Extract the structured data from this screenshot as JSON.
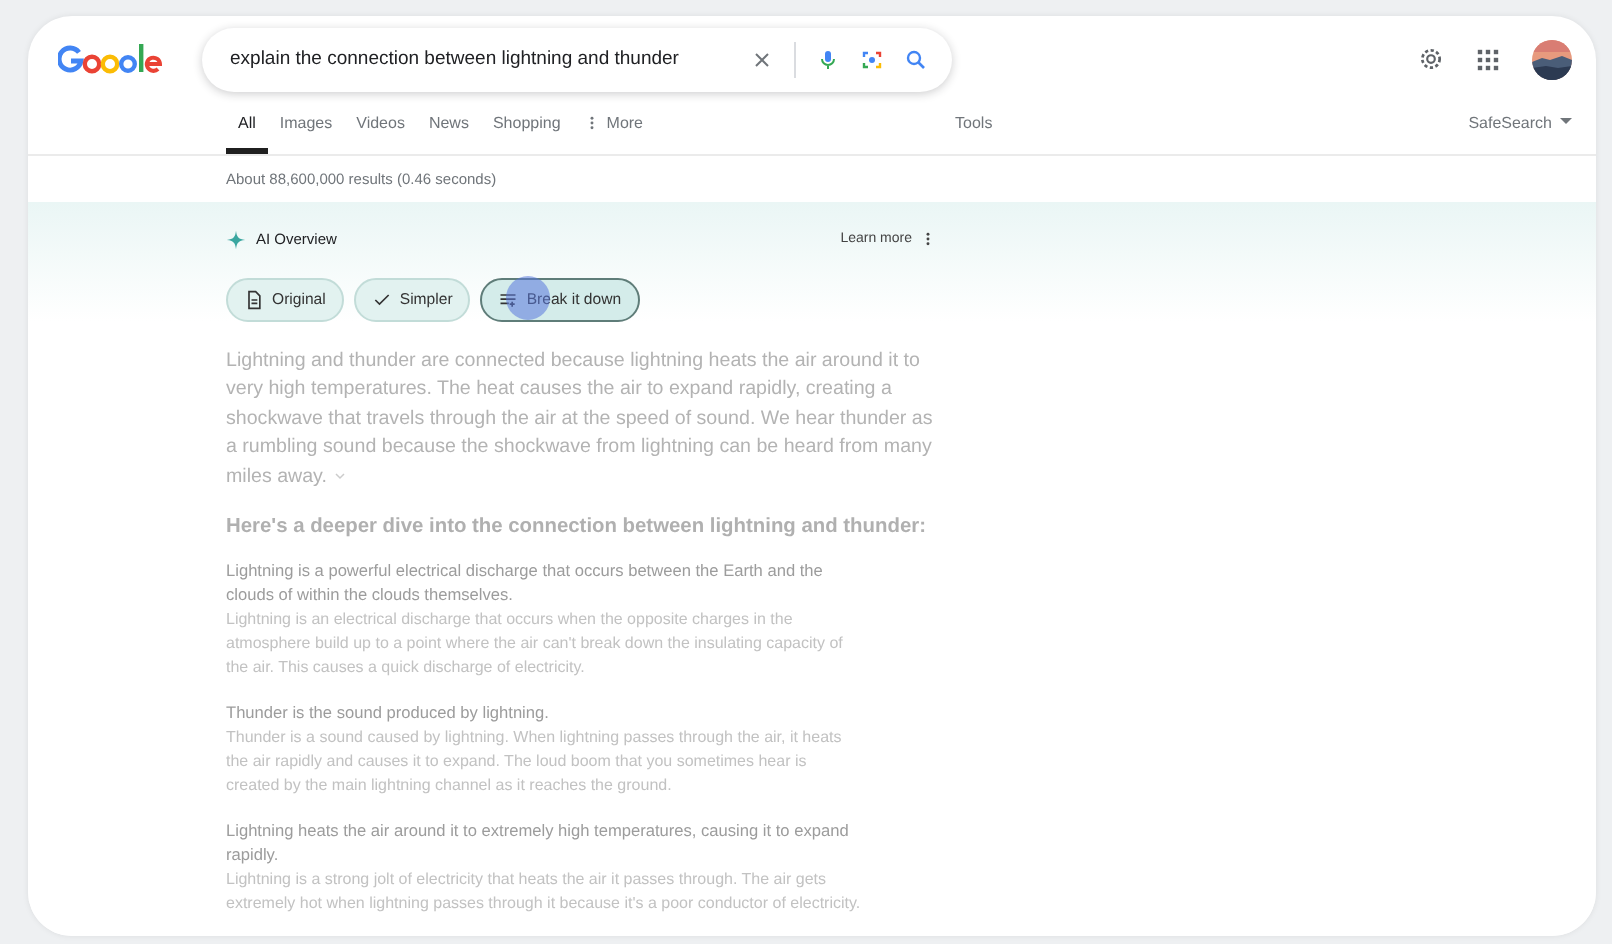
{
  "search": {
    "value": "explain the connection between lightning and thunder"
  },
  "tabs": [
    {
      "label": "All",
      "selected": true
    },
    {
      "label": "Images",
      "selected": false
    },
    {
      "label": "Videos",
      "selected": false
    },
    {
      "label": "News",
      "selected": false
    },
    {
      "label": "Shopping",
      "selected": false
    },
    {
      "label": "More",
      "selected": false,
      "kind": "more"
    }
  ],
  "tools": "Tools",
  "safesearch": "SafeSearch",
  "result_stats": "About 88,600,000 results (0.46 seconds)",
  "ai_overview": {
    "title": "AI Overview",
    "learn_more": "Learn more",
    "chips": [
      {
        "label": "Original",
        "kind": "document",
        "selected": false
      },
      {
        "label": "Simpler",
        "kind": "check",
        "selected": false
      },
      {
        "label": "Break it down",
        "kind": "list",
        "selected": true
      }
    ],
    "summary": "Lightning and thunder are connected because lightning heats the air around it to very high temperatures. The heat causes the air to expand rapidly, creating a shockwave that travels through the air at the speed of sound. We hear thunder as a rumbling sound because the shockwave from lightning can be heard from many miles away.",
    "deeper_heading": "Here's a deeper dive into the connection between lightning and thunder:",
    "points": [
      {
        "heading": "Lightning is a powerful electrical discharge that occurs between the Earth and the clouds of within the clouds themselves.",
        "detail": "Lightning is an electrical discharge that occurs when the opposite charges in the atmosphere build up to a point where the air can't break down the insulating capacity of the air. This causes a quick discharge of electricity."
      },
      {
        "heading": "Thunder is the sound produced by lightning.",
        "detail": "Thunder is a sound caused by lightning. When lightning passes through the air, it heats the air rapidly and causes it to expand. The loud boom that you sometimes hear is created by the main lightning channel as it reaches the ground."
      },
      {
        "heading": "Lightning heats the air around it to extremely high temperatures, causing it to expand rapidly.",
        "detail": "Lightning is a strong jolt of electricity that heats the air it passes through. The air gets extremely hot when lightning passes through it because it's a poor conductor of electricity."
      }
    ]
  }
}
